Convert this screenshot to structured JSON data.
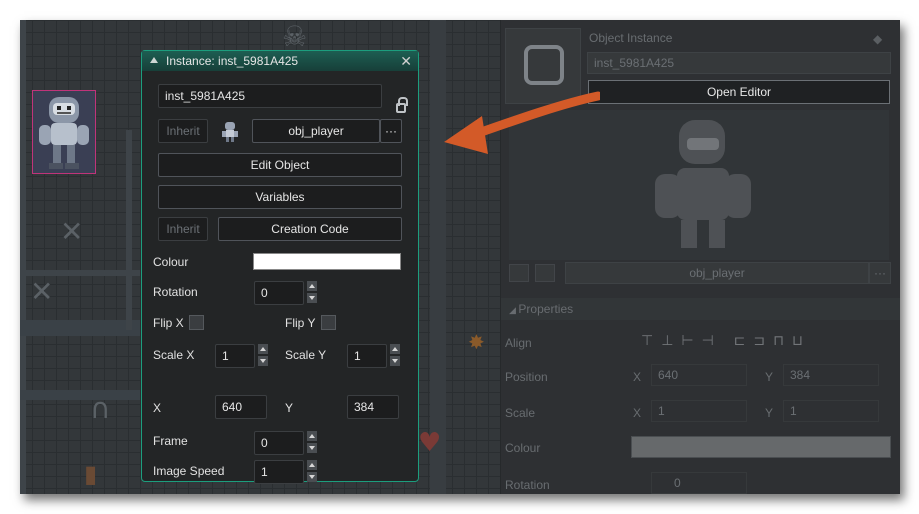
{
  "dialog": {
    "title": "Instance: inst_5981A425",
    "name_value": "inst_5981A425",
    "inherit_label": "Inherit",
    "object_value": "obj_player",
    "more_label": "···",
    "edit_object_label": "Edit Object",
    "variables_label": "Variables",
    "inherit2_label": "Inherit",
    "creation_code_label": "Creation Code",
    "colour_label": "Colour",
    "colour_value": "#ffffff",
    "rotation_label": "Rotation",
    "rotation_value": "0",
    "flip_x_label": "Flip X",
    "flip_y_label": "Flip Y",
    "scale_x_label": "Scale X",
    "scale_x_value": "1",
    "scale_y_label": "Scale Y",
    "scale_y_value": "1",
    "x_label": "X",
    "x_value": "640",
    "y_label": "Y",
    "y_value": "384",
    "frame_label": "Frame",
    "frame_value": "0",
    "image_speed_label": "Image Speed",
    "image_speed_value": "1",
    "close_glyph": "✕"
  },
  "inspector": {
    "header": "Object Instance",
    "name_value": "inst_5981A425",
    "open_editor_label": "Open Editor",
    "object_value": "obj_player",
    "more_label": "···",
    "properties_label": "Properties",
    "align_label": "Align",
    "position_label": "Position",
    "pos_x_label": "X",
    "pos_x_value": "640",
    "pos_y_label": "Y",
    "pos_y_value": "384",
    "scale_label": "Scale",
    "scale_x_label": "X",
    "scale_x_value": "1",
    "scale_y_label": "Y",
    "scale_y_value": "1",
    "colour_label": "Colour",
    "rotation_label": "Rotation",
    "rotation_value": "0"
  },
  "colors": {
    "dialog_accent": "#1c9e7e",
    "arrow": "#d35a28"
  }
}
